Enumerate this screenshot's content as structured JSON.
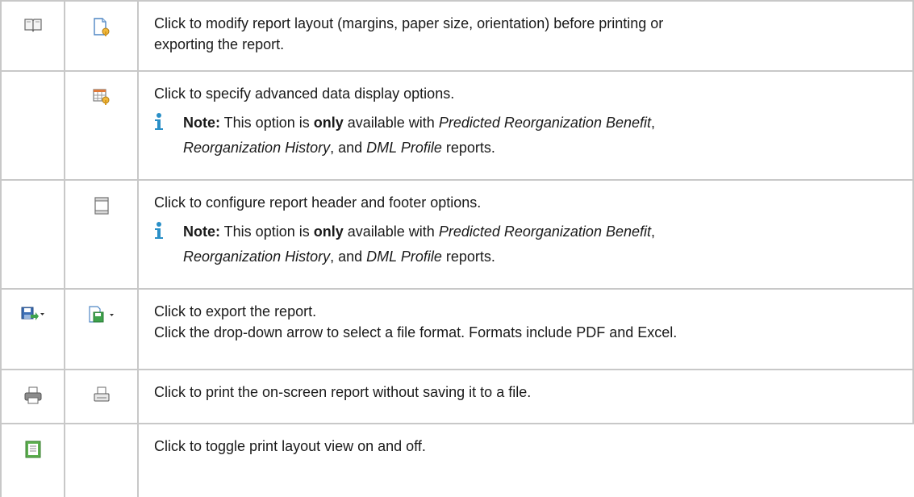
{
  "rows": [
    {
      "icon1": "book-icon",
      "icon2": "page-setup-icon",
      "lines": [
        "Click to modify report layout (margins, paper size, orientation) before printing or",
        "exporting the report."
      ]
    },
    {
      "icon2": "table-options-icon",
      "text": "Click to specify advanced data display options.",
      "note": {
        "label": "Note:",
        "t1": " This option is ",
        "only": "only",
        "t2": " available with ",
        "r1": "Predicted Reorganization Benefit",
        "t3": ",",
        "r2": "Reorganization History",
        "t4": ", and ",
        "r3": "DML Profile",
        "t5": " reports."
      }
    },
    {
      "icon2": "header-footer-icon",
      "text": "Click to configure report header and footer options.",
      "note": {
        "label": "Note:",
        "t1": " This option is ",
        "only": "only",
        "t2": " available with ",
        "r1": "Predicted Reorganization Benefit",
        "t3": ",",
        "r2": "Reorganization History",
        "t4": ", and ",
        "r3": "DML Profile",
        "t5": " reports."
      }
    },
    {
      "icon1": "export-dropdown-icon",
      "icon2": "save-dropdown-icon",
      "text": "Click to export the report.",
      "text2": "Click the drop-down arrow to select a file format. Formats include PDF and Excel."
    },
    {
      "icon1": "printer-icon",
      "icon2": "quick-print-icon",
      "text": "Click to print the on-screen report without saving it to a file."
    },
    {
      "icon1": "print-layout-icon",
      "text": "Click to toggle print layout view on and off."
    }
  ],
  "colors": {
    "border": "#c8c8c8",
    "note_icon": "#2a8fc7",
    "text": "#1a1a1a"
  }
}
